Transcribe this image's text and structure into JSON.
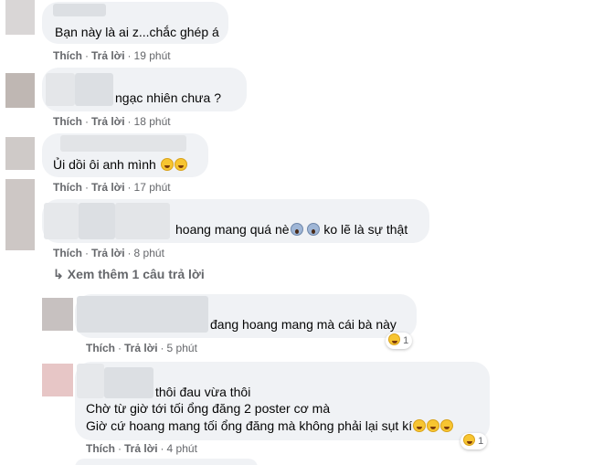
{
  "comments": [
    {
      "text": "Bạn này là ai z...chắc ghép á",
      "like": "Thích",
      "reply": "Trả lời",
      "time": "19 phút"
    },
    {
      "text": "ngạc nhiên chưa ?",
      "like": "Thích",
      "reply": "Trả lời",
      "time": "18 phút"
    },
    {
      "text": "Ủi dồi ôi anh mình",
      "like": "Thích",
      "reply": "Trả lời",
      "time": "17 phút"
    },
    {
      "text_a": "hoang mang quá nè",
      "text_b": "ko lẽ là sự thật",
      "like": "Thích",
      "reply": "Trả lời",
      "time": "8 phút"
    }
  ],
  "more_replies": "Xem thêm 1 câu trả lời",
  "replies": [
    {
      "text": "đang hoang mang mà cái bà này",
      "like": "Thích",
      "reply": "Trả lời",
      "time": "5 phút",
      "reaction_count": "1"
    },
    {
      "line1": "thôi đau vừa thôi",
      "line2": "Chờ từ giờ tới tối ổng đăng 2 poster cơ mà",
      "line3": "Giờ cứ hoang mang tối ổng đăng mà không phải lại sụt kí",
      "like": "Thích",
      "reply": "Trả lời",
      "time": "4 phút",
      "reaction_count": "1"
    }
  ],
  "icons": {
    "arrow": "reply-arrow-icon",
    "laugh": "grinning-squinting-face-emoji",
    "scream": "face-screaming-emoji"
  }
}
